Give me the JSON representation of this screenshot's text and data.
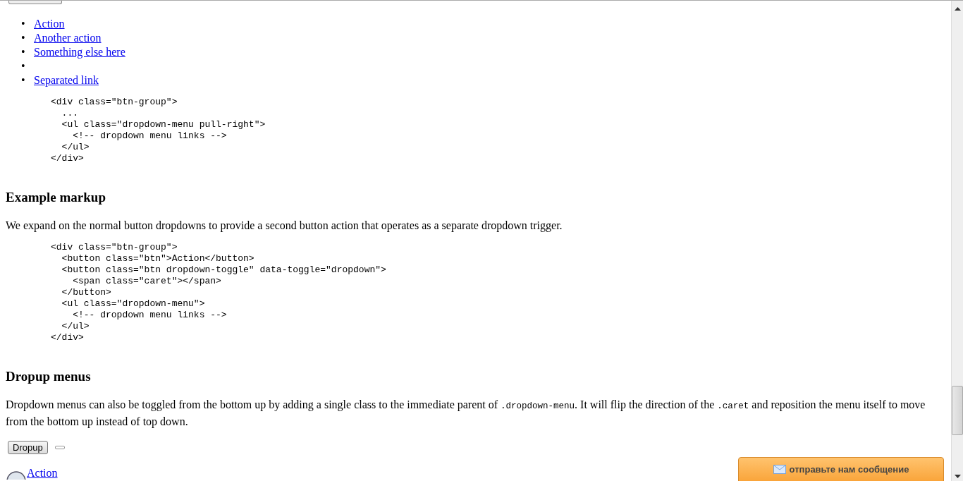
{
  "menu_links": [
    {
      "marker": "•",
      "label": "Action"
    },
    {
      "marker": "•",
      "label": "Another action"
    },
    {
      "marker": "•",
      "label": "Something else here"
    },
    {
      "marker": "•"
    },
    {
      "marker": "•",
      "label": "Separated link"
    }
  ],
  "code_1": "<div class=\"btn-group\">\n  ...\n  <ul class=\"dropdown-menu pull-right\">\n    <!-- dropdown menu links -->\n  </ul>\n</div>",
  "sections": [
    {
      "heading": "Example markup",
      "paragraph": [
        {
          "kind": "text",
          "text": "We expand on the normal button dropdowns to provide a second button action that operates as a separate dropdown trigger."
        }
      ],
      "code": "<div class=\"btn-group\">\n  <button class=\"btn\">Action</button>\n  <button class=\"btn dropdown-toggle\" data-toggle=\"dropdown\">\n    <span class=\"caret\"></span>\n  </button>\n  <ul class=\"dropdown-menu\">\n    <!-- dropdown menu links -->\n  </ul>\n</div>"
    },
    {
      "heading": "Dropup menus",
      "paragraph": [
        {
          "kind": "text",
          "text": "Dropdown menus can also be toggled from the bottom up by adding a single class to the immediate parent of "
        },
        {
          "kind": "code",
          "text": ".dropdown-menu"
        },
        {
          "kind": "text",
          "text": ". It will flip the direction of the "
        },
        {
          "kind": "code",
          "text": ".caret"
        },
        {
          "kind": "text",
          "text": " and reposition the menu itself to move from the bottom up instead of top down."
        }
      ]
    }
  ],
  "dropup_button": "Dropup",
  "bottom_link": "Action",
  "feedback_button": "отправьте нам сообщение"
}
